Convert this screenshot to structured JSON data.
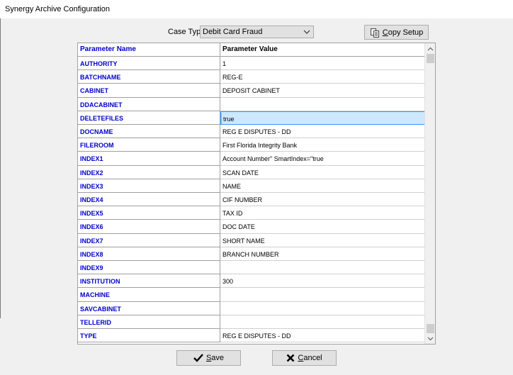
{
  "window": {
    "title": "Synergy Archive Configuration"
  },
  "case_type": {
    "label": "Case Type",
    "value": "Debit Card Fraud"
  },
  "buttons": {
    "copy_setup": {
      "accel": "C",
      "rest": "opy Setup"
    },
    "save": {
      "accel": "S",
      "rest": "ave"
    },
    "cancel": {
      "accel": "C",
      "rest": "ancel"
    }
  },
  "grid": {
    "headers": {
      "name": "Parameter Name",
      "value": "Parameter Value"
    },
    "selected_row": 4,
    "rows": [
      {
        "name": "AUTHORITY",
        "value": "1"
      },
      {
        "name": "BATCHNAME",
        "value": "REG-E"
      },
      {
        "name": "CABINET",
        "value": "DEPOSIT CABINET"
      },
      {
        "name": "DDACABINET",
        "value": ""
      },
      {
        "name": "DELETEFILES",
        "value": "true"
      },
      {
        "name": "DOCNAME",
        "value": "REG E DISPUTES - DD"
      },
      {
        "name": "FILEROOM",
        "value": "First Florida Integrity Bank"
      },
      {
        "name": "INDEX1",
        "value": "Account Number\" SmartIndex=\"true"
      },
      {
        "name": "INDEX2",
        "value": "SCAN DATE"
      },
      {
        "name": "INDEX3",
        "value": "NAME"
      },
      {
        "name": "INDEX4",
        "value": "CIF NUMBER"
      },
      {
        "name": "INDEX5",
        "value": "TAX ID"
      },
      {
        "name": "INDEX6",
        "value": "DOC DATE"
      },
      {
        "name": "INDEX7",
        "value": "SHORT NAME"
      },
      {
        "name": "INDEX8",
        "value": "BRANCH NUMBER"
      },
      {
        "name": "INDEX9",
        "value": ""
      },
      {
        "name": "INSTITUTION",
        "value": "300"
      },
      {
        "name": "MACHINE",
        "value": ""
      },
      {
        "name": "SAVCABINET",
        "value": ""
      },
      {
        "name": "TELLERID",
        "value": ""
      },
      {
        "name": "TYPE",
        "value": "REG E DISPUTES - DD"
      }
    ]
  },
  "icons": {
    "dropdown": "chevron-down-icon",
    "copy": "copy-icon",
    "save": "checkmark-icon",
    "cancel": "x-icon",
    "scroll_up": "scroll-up-icon",
    "scroll_down": "scroll-down-icon"
  }
}
